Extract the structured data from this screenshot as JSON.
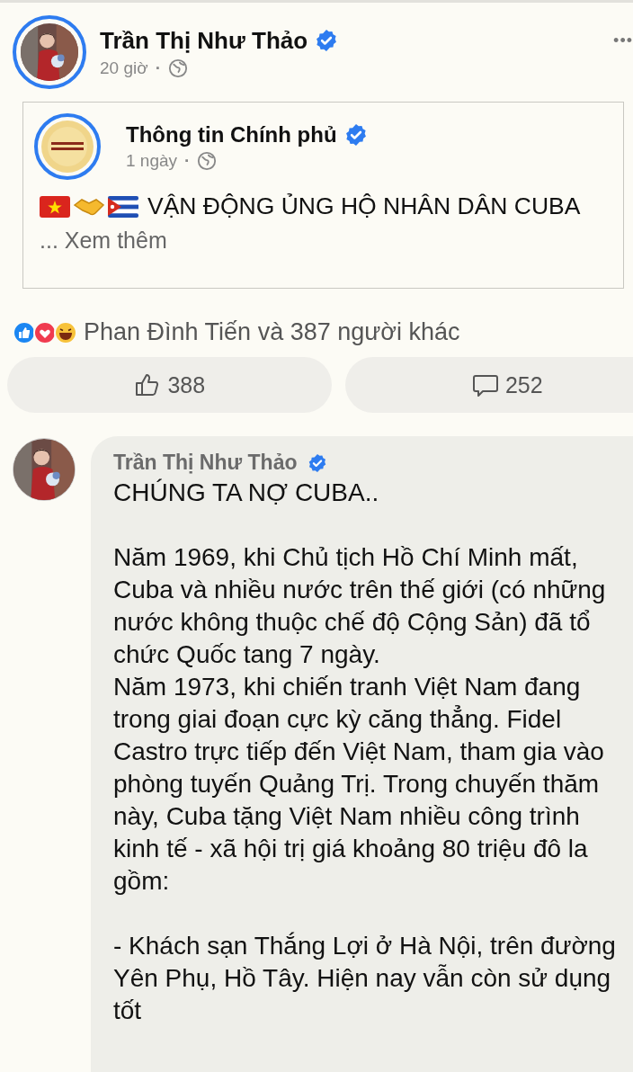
{
  "post": {
    "author": "Trần Thị Như Thảo",
    "verified": true,
    "time": "20 giờ",
    "separator": "·",
    "more": "•••"
  },
  "shared": {
    "author": "Thông tin Chính phủ",
    "verified": true,
    "time": "1 ngày",
    "separator": "·",
    "text": "VẬN ĐỘNG ỦNG HỘ NHÂN DÂN CUBA",
    "more": "... Xem thêm"
  },
  "reactions": {
    "summary": "Phan Đình Tiến và 387 người khác"
  },
  "actions": [
    {
      "kind": "like",
      "count": "388"
    },
    {
      "kind": "comment",
      "count": "252"
    }
  ],
  "comment": {
    "author": "Trần Thị Như Thảo",
    "verified": true,
    "blocks": [
      [
        "CHÚNG TA NỢ CUBA.."
      ],
      [
        "Năm 1969, khi Chủ tịch Hồ Chí Minh mất, Cuba và nhiều nước trên thế giới (có những nước không thuộc chế độ Cộng Sản) đã tổ chức Quốc tang 7 ngày.",
        "Năm 1973, khi chiến tranh Việt Nam đang trong giai đoạn cực kỳ căng thẳng. Fidel Castro trực tiếp đến Việt Nam, tham gia vào phòng tuyến Quảng Trị. Trong chuyến thăm này, Cuba tặng Việt Nam nhiều công trình kinh tế - xã hội trị giá khoảng 80 triệu đô la gồm:"
      ],
      [
        "- Khách sạn Thắng Lợi ở Hà Nội, trên đường Yên Phụ, Hồ Tây. Hiện nay vẫn còn sử dụng tốt"
      ]
    ]
  }
}
